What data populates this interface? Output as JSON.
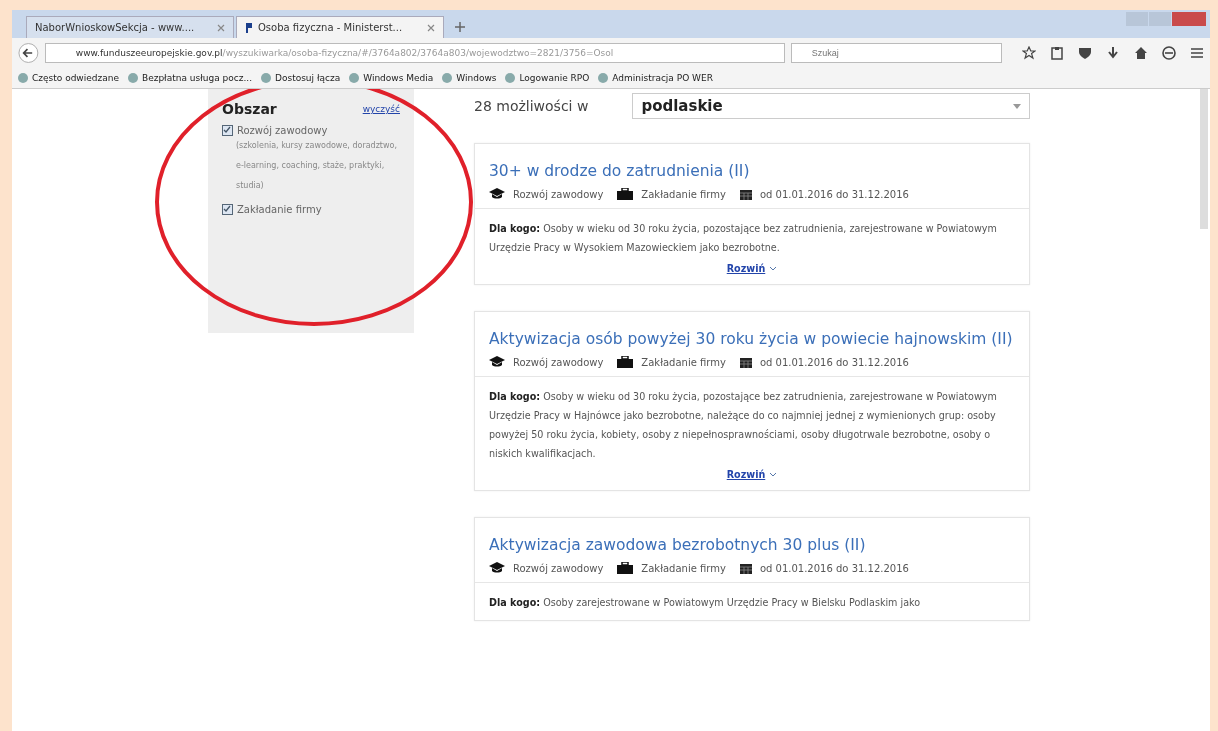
{
  "browser": {
    "tabs": [
      {
        "label": "NaborWnioskowSekcja - www....",
        "selected": false
      },
      {
        "label": "Osoba fizyczna - Ministerst...",
        "selected": true
      }
    ],
    "url": {
      "domain": "www.funduszeeuropejskie.gov.pl",
      "path": "/wyszukiwarka/osoba-fizyczna/#/3764a802/3764a803/wojewodztwo=2821/3756=Osol"
    },
    "search": {
      "placeholder": "Szukaj"
    },
    "bookmarks": [
      "Często odwiedzane",
      "Bezpłatna usługa pocz...",
      "Dostosuj łącza",
      "Windows Media",
      "Windows",
      "Logowanie RPO",
      "Administracja PO WER"
    ]
  },
  "filter": {
    "title": "Obszar",
    "clear": "wyczyść",
    "options": [
      {
        "label": "Rozwój zawodowy",
        "note": "(szkolenia, kursy zawodowe, doradztwo, e-learning, coaching, staże, praktyki, studia)",
        "checked": true
      },
      {
        "label": "Zakładanie firmy",
        "checked": true
      }
    ]
  },
  "results": {
    "count": "28 możliwości w",
    "region": "podlaskie"
  },
  "cards": [
    {
      "title": "30+ w drodze do zatrudnienia (II)",
      "tags": [
        "Rozwój zawodowy",
        "Zakładanie firmy",
        "od 01.01.2016 do 31.12.2016"
      ],
      "who_label": "Dla kogo:",
      "who": "Osoby w wieku od 30 roku życia, pozostające bez zatrudnienia, zarejestrowane w Powiatowym Urzędzie Pracy w Wysokiem Mazowieckiem jako bezrobotne.",
      "expand": "Rozwiń"
    },
    {
      "title": "Aktywizacja osób powyżej 30 roku życia w powiecie hajnowskim (II)",
      "tags": [
        "Rozwój zawodowy",
        "Zakładanie firmy",
        "od 01.01.2016 do 31.12.2016"
      ],
      "who_label": "Dla kogo:",
      "who": "Osoby w wieku od 30 roku życia, pozostające bez zatrudnienia, zarejestrowane w Powiatowym Urzędzie Pracy w Hajnówce jako bezrobotne, należące do co najmniej jednej z wymienionych grup: osoby powyżej 50 roku życia,  kobiety, osoby z niepełnosprawnościami, osoby długotrwale bezrobotne, osoby o niskich kwalifikacjach.",
      "expand": "Rozwiń"
    },
    {
      "title": "Aktywizacja zawodowa bezrobotnych 30 plus (II)",
      "tags": [
        "Rozwój zawodowy",
        "Zakładanie firmy",
        "od 01.01.2016 do 31.12.2016"
      ],
      "who_label": "Dla kogo:",
      "who": "Osoby zarejestrowane w Powiatowym Urzędzie Pracy w Bielsku Podlaskim jako"
    }
  ]
}
